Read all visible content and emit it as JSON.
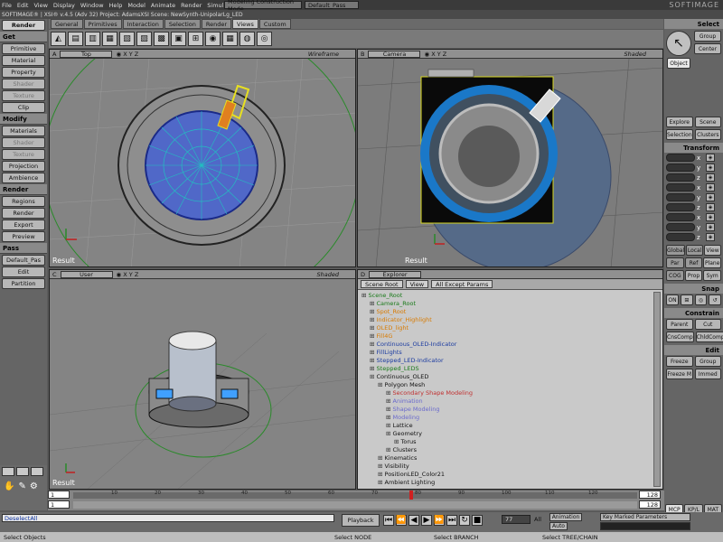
{
  "menubar": {
    "app": "SOFTIMAGE® | XSI® v.4.5 (Adv 32) Project: AdamsXSI  Scene: NewSynth-UnipolarLg_LED",
    "items": [
      "File",
      "Edit",
      "View",
      "Display",
      "Window",
      "Help",
      "Model",
      "Animate",
      "Render",
      "Simulate",
      "Hair"
    ],
    "mode": "Modeling Construction Mode",
    "pass": "Default_Pass",
    "brand": "SOFTIMAGE"
  },
  "left": {
    "module": "Render",
    "sections": [
      {
        "header": "Get",
        "items": [
          "Primitive",
          "Material",
          "Property",
          "Shader",
          "Texture",
          "Clip"
        ],
        "disabled": [
          false,
          false,
          false,
          true,
          true,
          false
        ]
      },
      {
        "header": "Modify",
        "items": [
          "Materials",
          "Shader",
          "Texture",
          "Projection",
          "Ambience"
        ],
        "disabled": [
          false,
          true,
          true,
          false,
          false
        ]
      },
      {
        "header": "Render",
        "items": [
          "Regions",
          "Render",
          "Export",
          "Preview"
        ],
        "disabled": [
          false,
          false,
          false,
          false
        ]
      },
      {
        "header": "Pass",
        "items": [
          "Default_Pas",
          "Edit",
          "Partition"
        ],
        "disabled": [
          false,
          false,
          false
        ]
      }
    ]
  },
  "tabs": [
    "General",
    "Primitives",
    "Interaction",
    "Selection",
    "Render",
    "Views",
    "Custom"
  ],
  "tools": [
    "◭",
    "▤",
    "▥",
    "▦",
    "▧",
    "▨",
    "▩",
    "▣",
    "⊞",
    "◉",
    "▦",
    "◍",
    "◎"
  ],
  "viewports": {
    "a": {
      "id": "A",
      "view": "Top",
      "mode": "Wireframe",
      "label": "Result"
    },
    "b": {
      "id": "B",
      "view": "Camera",
      "mode": "Shaded",
      "label": "Result"
    },
    "c": {
      "id": "C",
      "view": "User",
      "mode": "Shaded",
      "label": "Result"
    },
    "d": {
      "id": "D",
      "view": "Explorer"
    }
  },
  "explorer": {
    "buttons": [
      "Scene Root",
      "View",
      "All Except Params"
    ],
    "nodes": [
      {
        "t": "Scene_Root",
        "c": "#1a7a1a",
        "d": 0
      },
      {
        "t": "Camera_Root",
        "c": "#1a7a1a",
        "d": 1
      },
      {
        "t": "Spot_Root",
        "c": "#d87a00",
        "d": 1
      },
      {
        "t": "Indicator_Highlight",
        "c": "#d87a00",
        "d": 1
      },
      {
        "t": "OLED_light",
        "c": "#d87a00",
        "d": 1
      },
      {
        "t": "Fill4G",
        "c": "#d87a00",
        "d": 1
      },
      {
        "t": "Continuous_OLED-Indicator",
        "c": "#1a3aa0",
        "d": 1
      },
      {
        "t": "FillLights",
        "c": "#1a3aa0",
        "d": 1
      },
      {
        "t": "Stepped_LED-Indicator",
        "c": "#1a3aa0",
        "d": 1
      },
      {
        "t": "Stepped_LEDS",
        "c": "#1a7a1a",
        "d": 1
      },
      {
        "t": "Continuous_OLED",
        "c": "#111",
        "d": 1
      },
      {
        "t": "Polygon Mesh",
        "c": "#111",
        "d": 2
      },
      {
        "t": "Secondary Shape Modeling",
        "c": "#c03030",
        "d": 3
      },
      {
        "t": "Animation",
        "c": "#6a6acc",
        "d": 3
      },
      {
        "t": "Shape Modeling",
        "c": "#6a6acc",
        "d": 3
      },
      {
        "t": "Modeling",
        "c": "#6a6acc",
        "d": 3
      },
      {
        "t": "Lattice",
        "c": "#111",
        "d": 3
      },
      {
        "t": "Geometry",
        "c": "#111",
        "d": 3
      },
      {
        "t": "Torus",
        "c": "#111",
        "d": 4
      },
      {
        "t": "Clusters",
        "c": "#111",
        "d": 3
      },
      {
        "t": "Kinematics",
        "c": "#111",
        "d": 2
      },
      {
        "t": "Visibility",
        "c": "#111",
        "d": 2
      },
      {
        "t": "PositionLED_Color21",
        "c": "#111",
        "d": 2
      },
      {
        "t": "Ambient Lighting",
        "c": "#111",
        "d": 2
      }
    ]
  },
  "right": {
    "select": "Select",
    "group": "Group",
    "center": "Center",
    "object": "Object",
    "explore": "Explore",
    "scene": "Scene",
    "selection": "Selection",
    "clusters": "Clusters",
    "transform": "Transform",
    "axes": [
      "x",
      "y",
      "z"
    ],
    "global": "Global",
    "local": "Local",
    "view": "View",
    "par": "Par",
    "ref": "Ref",
    "plane": "Plane",
    "cog": "COG",
    "prop": "Prop",
    "sym": "Sym",
    "snap": "Snap",
    "on": "ON",
    "constrain": "Constrain",
    "parent": "Parent",
    "cut": "Cut",
    "cnscomp": "CnsComp",
    "chldcomp": "ChldComp",
    "edit": "Edit",
    "freeze": "Freeze",
    "group2": "Group",
    "freezem": "Freeze M",
    "immed": "Immed",
    "mcp": "MCP",
    "kpl": "KP/L",
    "mat": "MAT"
  },
  "timeline": {
    "start": "1",
    "end": "128",
    "end2": "128",
    "frame": "1",
    "ticks": [
      "10",
      "20",
      "30",
      "40",
      "50",
      "60",
      "70",
      "80",
      "90",
      "100",
      "110",
      "120"
    ]
  },
  "bottom": {
    "script": "DeselectAll",
    "playback": "Playback",
    "frame": "77",
    "all": "All",
    "animation": "Animation",
    "auto": "Auto",
    "kmp": "Key Marked Parameters"
  },
  "status": {
    "main": "Select Objects",
    "node": "Select NODE",
    "branch": "Select BRANCH",
    "tree": "Select TREE/CHAIN"
  }
}
